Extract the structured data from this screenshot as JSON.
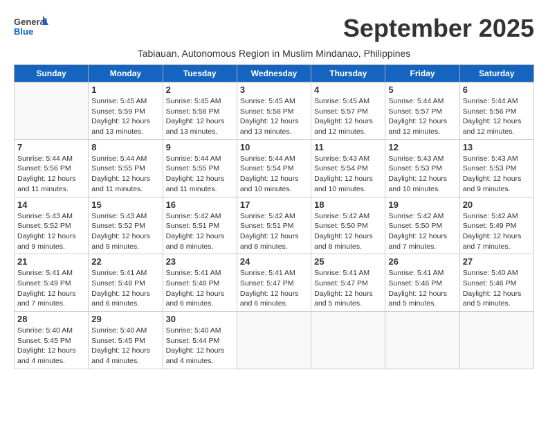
{
  "header": {
    "logo_general": "General",
    "logo_blue": "Blue",
    "month_title": "September 2025",
    "subtitle": "Tabiauan, Autonomous Region in Muslim Mindanao, Philippines"
  },
  "days_of_week": [
    "Sunday",
    "Monday",
    "Tuesday",
    "Wednesday",
    "Thursday",
    "Friday",
    "Saturday"
  ],
  "weeks": [
    [
      {
        "day": "",
        "info": ""
      },
      {
        "day": "1",
        "info": "Sunrise: 5:45 AM\nSunset: 5:59 PM\nDaylight: 12 hours\nand 13 minutes."
      },
      {
        "day": "2",
        "info": "Sunrise: 5:45 AM\nSunset: 5:58 PM\nDaylight: 12 hours\nand 13 minutes."
      },
      {
        "day": "3",
        "info": "Sunrise: 5:45 AM\nSunset: 5:58 PM\nDaylight: 12 hours\nand 13 minutes."
      },
      {
        "day": "4",
        "info": "Sunrise: 5:45 AM\nSunset: 5:57 PM\nDaylight: 12 hours\nand 12 minutes."
      },
      {
        "day": "5",
        "info": "Sunrise: 5:44 AM\nSunset: 5:57 PM\nDaylight: 12 hours\nand 12 minutes."
      },
      {
        "day": "6",
        "info": "Sunrise: 5:44 AM\nSunset: 5:56 PM\nDaylight: 12 hours\nand 12 minutes."
      }
    ],
    [
      {
        "day": "7",
        "info": "Sunrise: 5:44 AM\nSunset: 5:56 PM\nDaylight: 12 hours\nand 11 minutes."
      },
      {
        "day": "8",
        "info": "Sunrise: 5:44 AM\nSunset: 5:55 PM\nDaylight: 12 hours\nand 11 minutes."
      },
      {
        "day": "9",
        "info": "Sunrise: 5:44 AM\nSunset: 5:55 PM\nDaylight: 12 hours\nand 11 minutes."
      },
      {
        "day": "10",
        "info": "Sunrise: 5:44 AM\nSunset: 5:54 PM\nDaylight: 12 hours\nand 10 minutes."
      },
      {
        "day": "11",
        "info": "Sunrise: 5:43 AM\nSunset: 5:54 PM\nDaylight: 12 hours\nand 10 minutes."
      },
      {
        "day": "12",
        "info": "Sunrise: 5:43 AM\nSunset: 5:53 PM\nDaylight: 12 hours\nand 10 minutes."
      },
      {
        "day": "13",
        "info": "Sunrise: 5:43 AM\nSunset: 5:53 PM\nDaylight: 12 hours\nand 9 minutes."
      }
    ],
    [
      {
        "day": "14",
        "info": "Sunrise: 5:43 AM\nSunset: 5:52 PM\nDaylight: 12 hours\nand 9 minutes."
      },
      {
        "day": "15",
        "info": "Sunrise: 5:43 AM\nSunset: 5:52 PM\nDaylight: 12 hours\nand 9 minutes."
      },
      {
        "day": "16",
        "info": "Sunrise: 5:42 AM\nSunset: 5:51 PM\nDaylight: 12 hours\nand 8 minutes."
      },
      {
        "day": "17",
        "info": "Sunrise: 5:42 AM\nSunset: 5:51 PM\nDaylight: 12 hours\nand 8 minutes."
      },
      {
        "day": "18",
        "info": "Sunrise: 5:42 AM\nSunset: 5:50 PM\nDaylight: 12 hours\nand 8 minutes."
      },
      {
        "day": "19",
        "info": "Sunrise: 5:42 AM\nSunset: 5:50 PM\nDaylight: 12 hours\nand 7 minutes."
      },
      {
        "day": "20",
        "info": "Sunrise: 5:42 AM\nSunset: 5:49 PM\nDaylight: 12 hours\nand 7 minutes."
      }
    ],
    [
      {
        "day": "21",
        "info": "Sunrise: 5:41 AM\nSunset: 5:49 PM\nDaylight: 12 hours\nand 7 minutes."
      },
      {
        "day": "22",
        "info": "Sunrise: 5:41 AM\nSunset: 5:48 PM\nDaylight: 12 hours\nand 6 minutes."
      },
      {
        "day": "23",
        "info": "Sunrise: 5:41 AM\nSunset: 5:48 PM\nDaylight: 12 hours\nand 6 minutes."
      },
      {
        "day": "24",
        "info": "Sunrise: 5:41 AM\nSunset: 5:47 PM\nDaylight: 12 hours\nand 6 minutes."
      },
      {
        "day": "25",
        "info": "Sunrise: 5:41 AM\nSunset: 5:47 PM\nDaylight: 12 hours\nand 5 minutes."
      },
      {
        "day": "26",
        "info": "Sunrise: 5:41 AM\nSunset: 5:46 PM\nDaylight: 12 hours\nand 5 minutes."
      },
      {
        "day": "27",
        "info": "Sunrise: 5:40 AM\nSunset: 5:46 PM\nDaylight: 12 hours\nand 5 minutes."
      }
    ],
    [
      {
        "day": "28",
        "info": "Sunrise: 5:40 AM\nSunset: 5:45 PM\nDaylight: 12 hours\nand 4 minutes."
      },
      {
        "day": "29",
        "info": "Sunrise: 5:40 AM\nSunset: 5:45 PM\nDaylight: 12 hours\nand 4 minutes."
      },
      {
        "day": "30",
        "info": "Sunrise: 5:40 AM\nSunset: 5:44 PM\nDaylight: 12 hours\nand 4 minutes."
      },
      {
        "day": "",
        "info": ""
      },
      {
        "day": "",
        "info": ""
      },
      {
        "day": "",
        "info": ""
      },
      {
        "day": "",
        "info": ""
      }
    ]
  ]
}
